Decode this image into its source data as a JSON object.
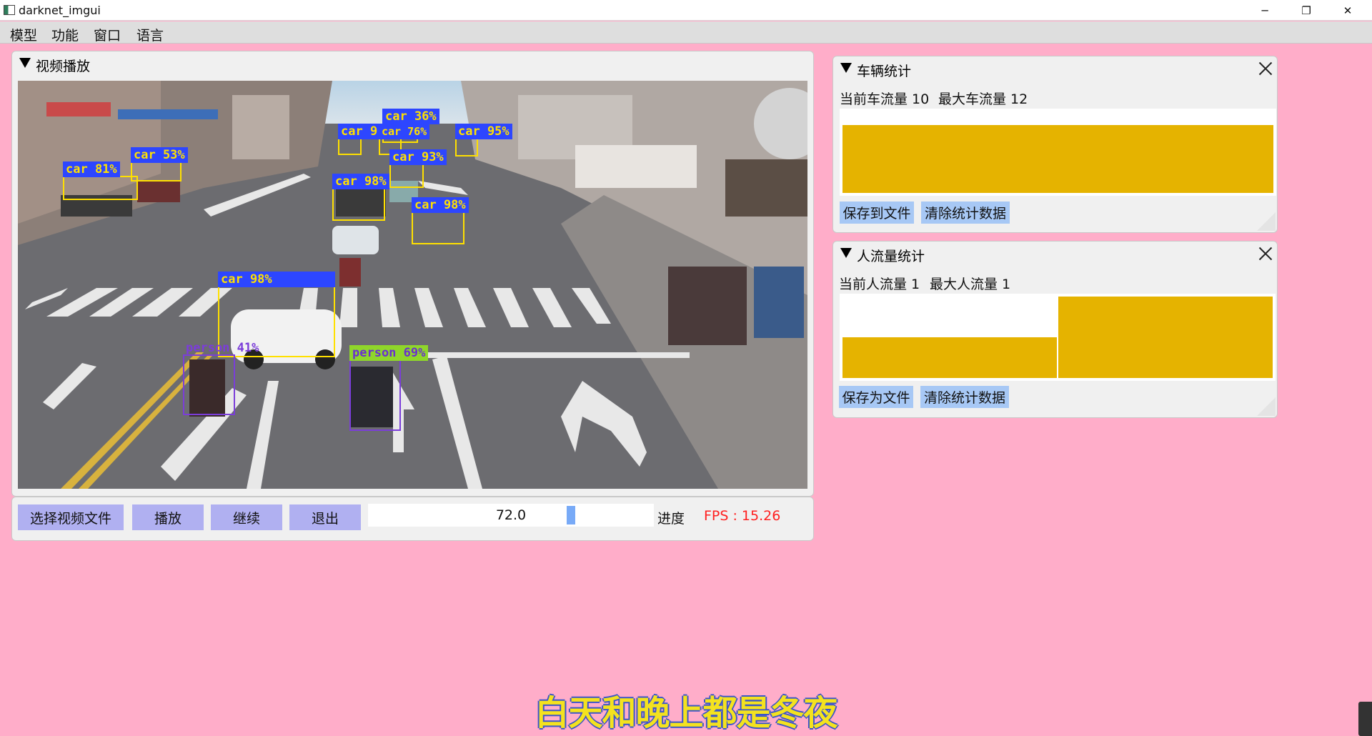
{
  "window": {
    "title": "darknet_imgui",
    "min": "─",
    "max": "❐",
    "close": "✕"
  },
  "menu": [
    "模型",
    "功能",
    "窗口",
    "语言"
  ],
  "video_panel": {
    "title": "视频播放",
    "overlay_text": "",
    "detections": [
      {
        "label": "car 81%"
      },
      {
        "label": "car 53%"
      },
      {
        "label": "car 36%"
      },
      {
        "label": "car 76%"
      },
      {
        "label": "car 9"
      },
      {
        "label": "car 95%"
      },
      {
        "label": "car 93%"
      },
      {
        "label": "car 98%"
      },
      {
        "label": "car 98%"
      },
      {
        "label": "car 98%"
      },
      {
        "label": "person 41%"
      },
      {
        "label": "person 69%"
      }
    ]
  },
  "controls": {
    "buttons": [
      "选择视频文件",
      "播放",
      "继续",
      "退出"
    ],
    "progress_value": "72.0",
    "progress_fraction": 0.72,
    "progress_label": "进度",
    "fps": "FPS : 15.26",
    "fps_color": "#ff2020"
  },
  "vehicle_panel": {
    "title": "车辆统计",
    "current_label": "当前车流量 10",
    "max_label": "最大车流量 12",
    "bar_color": "#e5b300",
    "bars": [
      10
    ],
    "max": 12,
    "save_button": "保存到文件",
    "clear_button": "清除统计数据"
  },
  "people_panel": {
    "title": "人流量统计",
    "current_label": "当前人流量 1",
    "max_label": "最大人流量 1",
    "bar_color": "#e5b300",
    "bars": [
      0.5,
      1
    ],
    "max": 1,
    "save_button": "保存为文件",
    "clear_button": "清除统计数据"
  },
  "subtitle": "白天和晚上都是冬夜"
}
